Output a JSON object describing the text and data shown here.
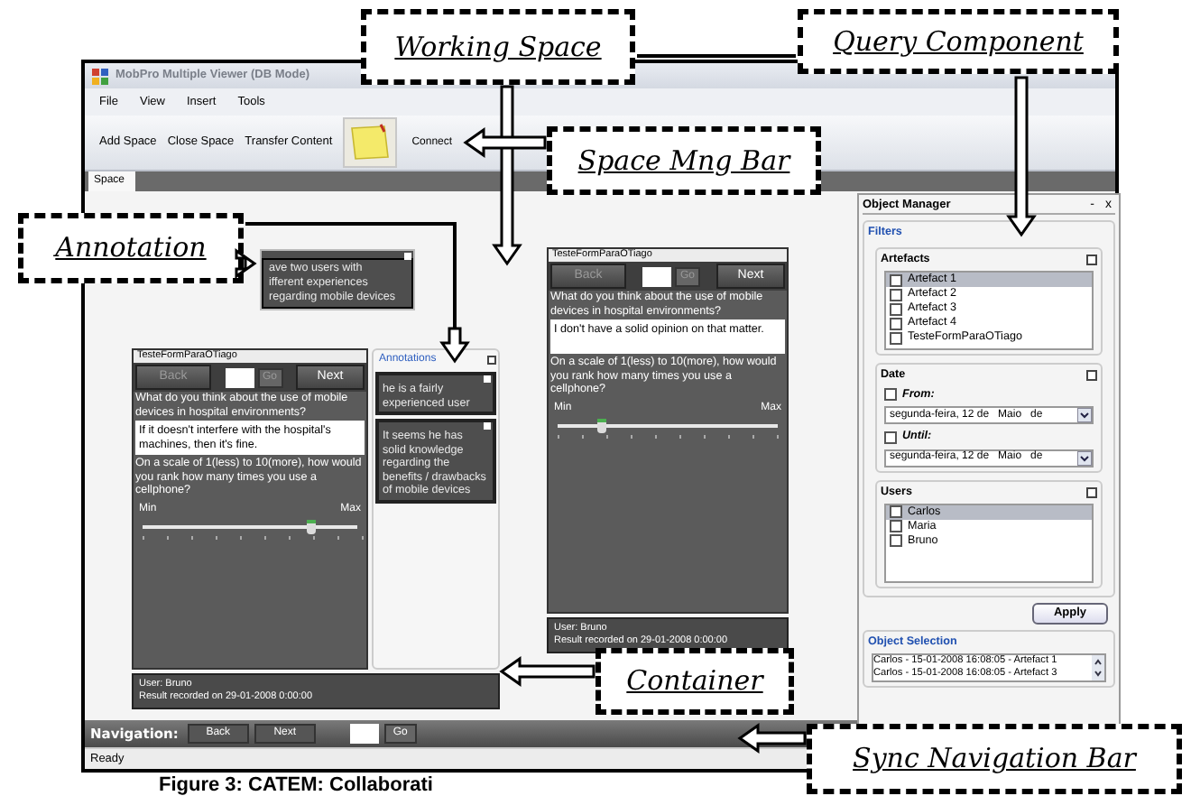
{
  "window": {
    "title": "MobPro Multiple Viewer (DB Mode)"
  },
  "menu": [
    "File",
    "View",
    "Insert",
    "Tools"
  ],
  "toolbar": {
    "buttons": [
      "Add Space",
      "Close Space",
      "Transfer Content"
    ],
    "connect": "Connect"
  },
  "tabs": [
    {
      "label": "Space",
      "selected": true
    }
  ],
  "floating_note": {
    "text": "ave two users with\nifferent experiences\nregarding mobile devices"
  },
  "containers": [
    {
      "form": {
        "title": "TesteFormParaOTiago",
        "back": "Back",
        "go": "Go",
        "next": "Next",
        "question": "What do you think about the use of mobile devices in hospital environments?",
        "answer": "If it doesn't interfere with the hospital's machines, then it's fine.",
        "question2": "On a scale of 1(less) to 10(more), how would you rank how many times you use a cellphone?",
        "min": "Min",
        "max": "Max",
        "level": 0.78
      },
      "annotations": {
        "label": "Annotations",
        "notes": [
          "he is a fairly experienced user",
          "It seems he has solid knowledge regarding the benefits / drawbacks of mobile devices"
        ]
      },
      "footer": {
        "user": "User: Bruno",
        "result": "Result recorded on 29-01-2008 0:00:00"
      }
    },
    {
      "form": {
        "title": "TesteFormParaOTiago",
        "back": "Back",
        "go": "Go",
        "next": "Next",
        "question": "What do you think about the use of mobile devices in hospital environments?",
        "answer": "I don't have a solid opinion on that matter.",
        "question2": "On a scale of 1(less) to 10(more), how would you rank how many times you use a cellphone?",
        "min": "Min",
        "max": "Max",
        "level": 0.2
      },
      "footer": {
        "user": "User: Bruno",
        "result": "Result recorded on 29-01-2008 0:00:00"
      }
    }
  ],
  "object_manager": {
    "title": "Object Manager",
    "minimize": "-",
    "close": "x",
    "filters_label": "Filters",
    "artefacts": {
      "label": "Artefacts",
      "items": [
        {
          "label": "Artefact 1",
          "checked": false,
          "selected": true
        },
        {
          "label": "Artefact 2",
          "checked": false,
          "selected": false
        },
        {
          "label": "Artefact 3",
          "checked": false,
          "selected": false
        },
        {
          "label": "Artefact 4",
          "checked": false,
          "selected": false
        },
        {
          "label": "TesteFormParaOTiago",
          "checked": false,
          "selected": false
        }
      ]
    },
    "date": {
      "label": "Date",
      "from": {
        "label": "From:",
        "checked": false,
        "value": "segunda-feira, 12 de   Maio   de"
      },
      "until": {
        "label": "Until:",
        "checked": false,
        "value": "segunda-feira, 12 de   Maio   de"
      }
    },
    "users": {
      "label": "Users",
      "items": [
        {
          "label": "Carlos",
          "checked": false,
          "selected": true
        },
        {
          "label": "Maria",
          "checked": false,
          "selected": false
        },
        {
          "label": "Bruno",
          "checked": false,
          "selected": false
        }
      ]
    },
    "apply": "Apply",
    "object_selection": {
      "label": "Object Selection",
      "items": [
        "Carlos - 15-01-2008 16:08:05 - Artefact 1",
        "Carlos - 15-01-2008 16:08:05 - Artefact 3"
      ]
    }
  },
  "navigation": {
    "label": "Navigation:",
    "back": "Back",
    "next": "Next",
    "go": "Go"
  },
  "status_bar": "Ready",
  "callouts": [
    {
      "text": "Working Space"
    },
    {
      "text": "Query Component"
    },
    {
      "text": "Space Mng Bar"
    },
    {
      "text": "Annotation"
    },
    {
      "text": "Container"
    },
    {
      "text": "Sync Navigation Bar"
    }
  ],
  "caption": "Figure 3: CATEM: Collaborati"
}
